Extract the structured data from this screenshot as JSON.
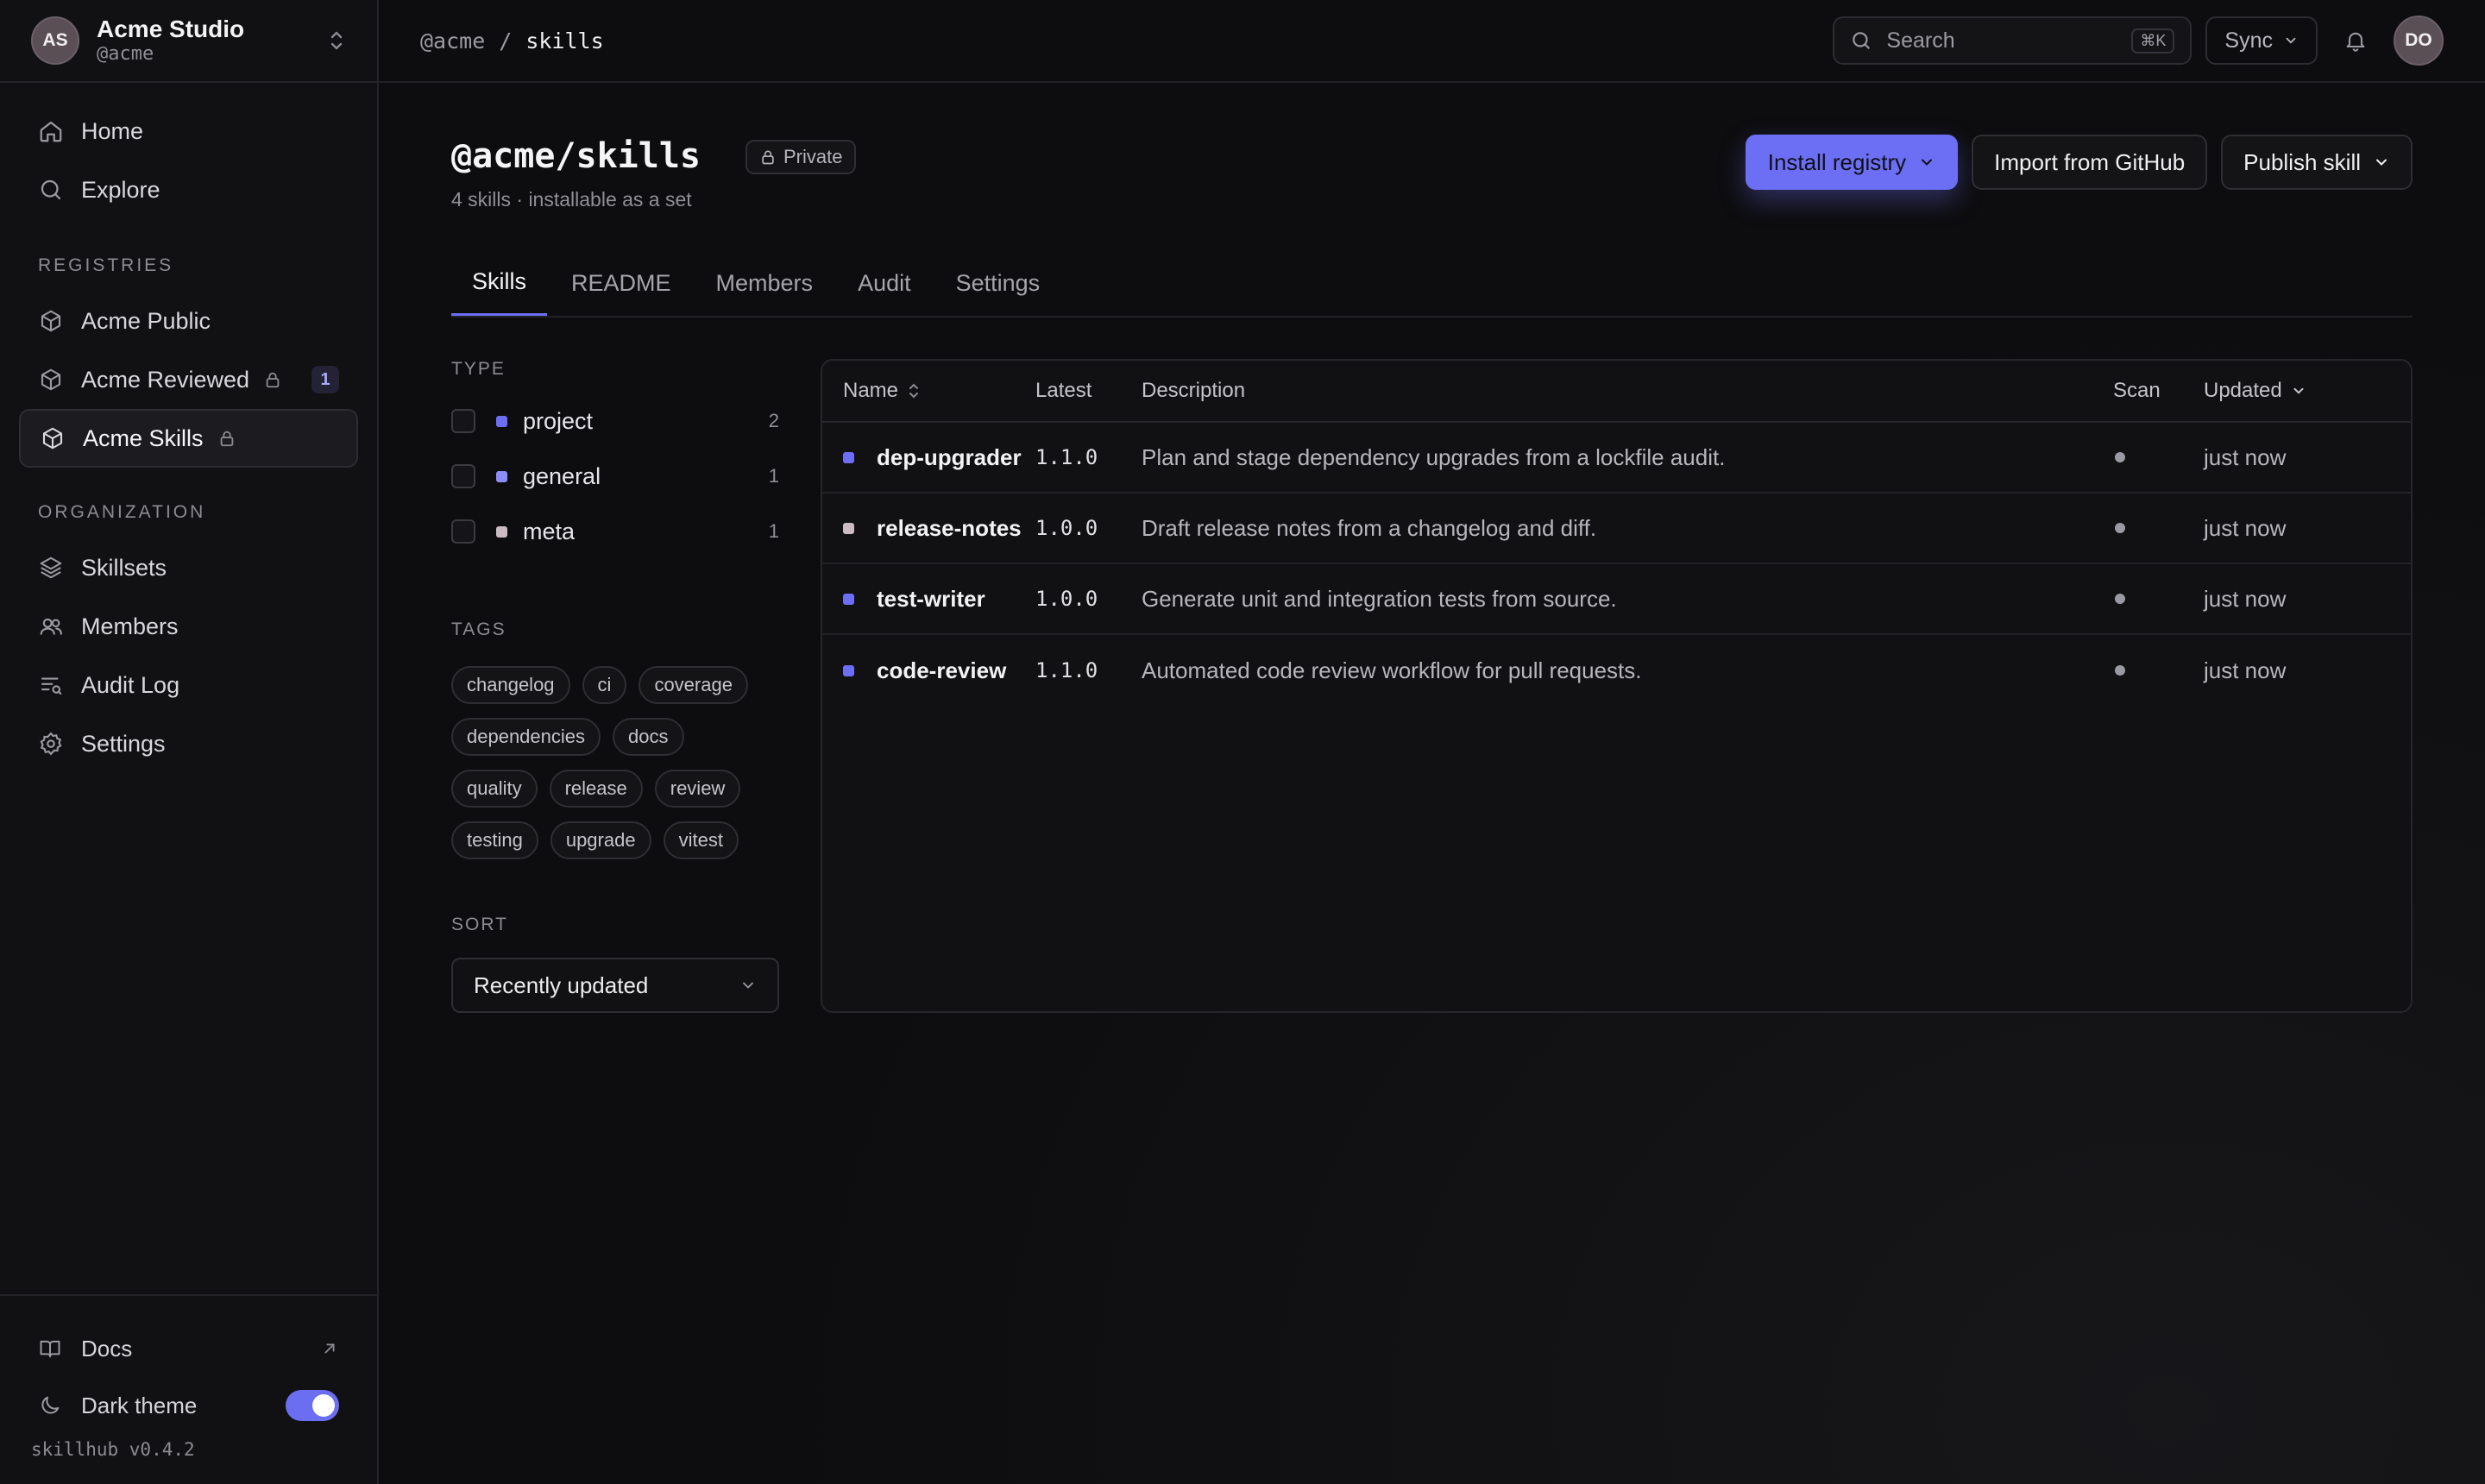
{
  "org": {
    "initials": "AS",
    "name": "Acme Studio",
    "handle": "@acme"
  },
  "nav_main": [
    {
      "label": "Home",
      "icon": "home-icon"
    },
    {
      "label": "Explore",
      "icon": "search-icon"
    }
  ],
  "registries_label": "REGISTRIES",
  "registries": [
    {
      "label": "Acme Public",
      "icon": "package-icon"
    },
    {
      "label": "Acme Reviewed",
      "icon": "package-icon",
      "private": true,
      "badge": "1"
    },
    {
      "label": "Acme Skills",
      "icon": "package-icon",
      "private": true,
      "active": true
    }
  ],
  "organization_label": "ORGANIZATION",
  "organization": [
    {
      "label": "Skillsets",
      "icon": "layers-icon"
    },
    {
      "label": "Members",
      "icon": "users-icon"
    },
    {
      "label": "Audit Log",
      "icon": "audit-log-icon"
    },
    {
      "label": "Settings",
      "icon": "gear-icon"
    }
  ],
  "sidebar_bottom": {
    "docs": "Docs",
    "dark_theme": "Dark theme",
    "dark_theme_on": true,
    "version": "skillhub v0.4.2"
  },
  "topbar": {
    "breadcrumb_org": "@acme",
    "breadcrumb_sep": "/",
    "breadcrumb_current": "skills",
    "search_placeholder": "Search",
    "search_shortcut": "⌘K",
    "sync_label": "Sync",
    "user_initials": "DO"
  },
  "page": {
    "title": "@acme/skills",
    "visibility": "Private",
    "subtitle": "4 skills · installable as a set",
    "install_label": "Install registry",
    "import_label": "Import from GitHub",
    "publish_label": "Publish skill"
  },
  "tabs": [
    "Skills",
    "README",
    "Members",
    "Audit",
    "Settings"
  ],
  "active_tab": "Skills",
  "filters": {
    "type_label": "TYPE",
    "types": [
      {
        "label": "project",
        "count": "2",
        "color": "#6c6ff3"
      },
      {
        "label": "general",
        "count": "1",
        "color": "#8b8cf5"
      },
      {
        "label": "meta",
        "count": "1",
        "color": "#cbbcc4"
      }
    ],
    "tags_label": "TAGS",
    "tags": [
      "changelog",
      "ci",
      "coverage",
      "dependencies",
      "docs",
      "quality",
      "release",
      "review",
      "testing",
      "upgrade",
      "vitest"
    ],
    "sort_label": "SORT",
    "sort_value": "Recently updated"
  },
  "table": {
    "headers": {
      "name": "Name",
      "latest": "Latest",
      "description": "Description",
      "scan": "Scan",
      "updated": "Updated"
    },
    "rows": [
      {
        "name": "dep-upgrader",
        "latest": "1.1.0",
        "description": "Plan and stage dependency upgrades from a lockfile audit.",
        "updated": "just now",
        "color": "#6c6ff3"
      },
      {
        "name": "release-notes",
        "latest": "1.0.0",
        "description": "Draft release notes from a changelog and diff.",
        "updated": "just now",
        "color": "#cbbcc4"
      },
      {
        "name": "test-writer",
        "latest": "1.0.0",
        "description": "Generate unit and integration tests from source.",
        "updated": "just now",
        "color": "#6c6ff3"
      },
      {
        "name": "code-review",
        "latest": "1.1.0",
        "description": "Automated code review workflow for pull requests.",
        "updated": "just now",
        "color": "#6c6ff3"
      }
    ]
  },
  "colors": {
    "accent": "#6c6ff3",
    "background": "#0d0d0f",
    "sidebar": "#111113"
  }
}
